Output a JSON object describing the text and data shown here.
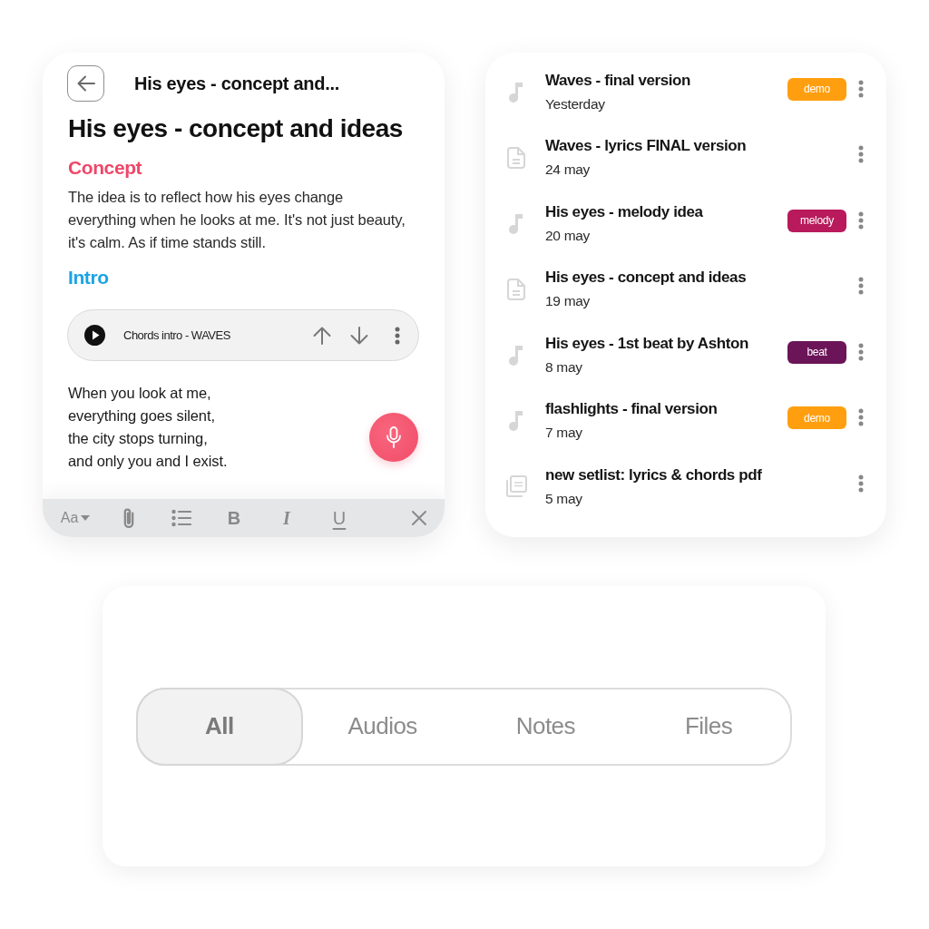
{
  "note": {
    "header_title": "His eyes - concept and...",
    "title": "His eyes - concept and ideas",
    "sections": [
      {
        "kind": "heading",
        "text": "Concept",
        "color": "#ef4769"
      },
      {
        "kind": "paragraph",
        "text": "The idea is to reflect how his eyes change everything when he looks at me. It's not just beauty, it's calm. As if time stands still."
      },
      {
        "kind": "heading",
        "text": "Intro",
        "color": "#1ba3e6"
      },
      {
        "kind": "audio",
        "title": "Chords intro - WAVES"
      },
      {
        "kind": "lyrics",
        "text": "When you look at me,\neverything goes silent,\nthe city stops turning,\nand only you and I exist."
      }
    ],
    "toolbar": [
      {
        "kind": "font",
        "label": "Aa"
      },
      {
        "kind": "attach"
      },
      {
        "kind": "list"
      },
      {
        "kind": "bold",
        "label": "B"
      },
      {
        "kind": "italic",
        "label": "I"
      },
      {
        "kind": "underline",
        "label": "U"
      },
      {
        "kind": "close"
      }
    ]
  },
  "files": [
    {
      "kind": "audio",
      "title": "Waves - final version",
      "date": "Yesterday",
      "tag": {
        "label": "demo",
        "color": "#ff9f10"
      }
    },
    {
      "kind": "note",
      "title": "Waves - lyrics FINAL version",
      "date": "24 may"
    },
    {
      "kind": "audio",
      "title": "His eyes - melody idea",
      "date": "20 may",
      "tag": {
        "label": "melody",
        "color": "#b81a5c"
      }
    },
    {
      "kind": "note",
      "title": "His eyes - concept and ideas",
      "date": "19 may"
    },
    {
      "kind": "audio",
      "title": "His eyes - 1st beat by Ashton",
      "date": "8 may",
      "tag": {
        "label": "beat",
        "color": "#6b1458"
      }
    },
    {
      "kind": "audio",
      "title": "flashlights - final version",
      "date": "7 may",
      "tag": {
        "label": "demo",
        "color": "#ff9f10"
      }
    },
    {
      "kind": "pdf",
      "title": "new setlist: lyrics & chords pdf",
      "date": "5 may"
    }
  ],
  "filter_tabs": [
    {
      "label": "All",
      "selected": true
    },
    {
      "label": "Audios",
      "selected": false
    },
    {
      "label": "Notes",
      "selected": false
    },
    {
      "label": "Files",
      "selected": false
    }
  ]
}
